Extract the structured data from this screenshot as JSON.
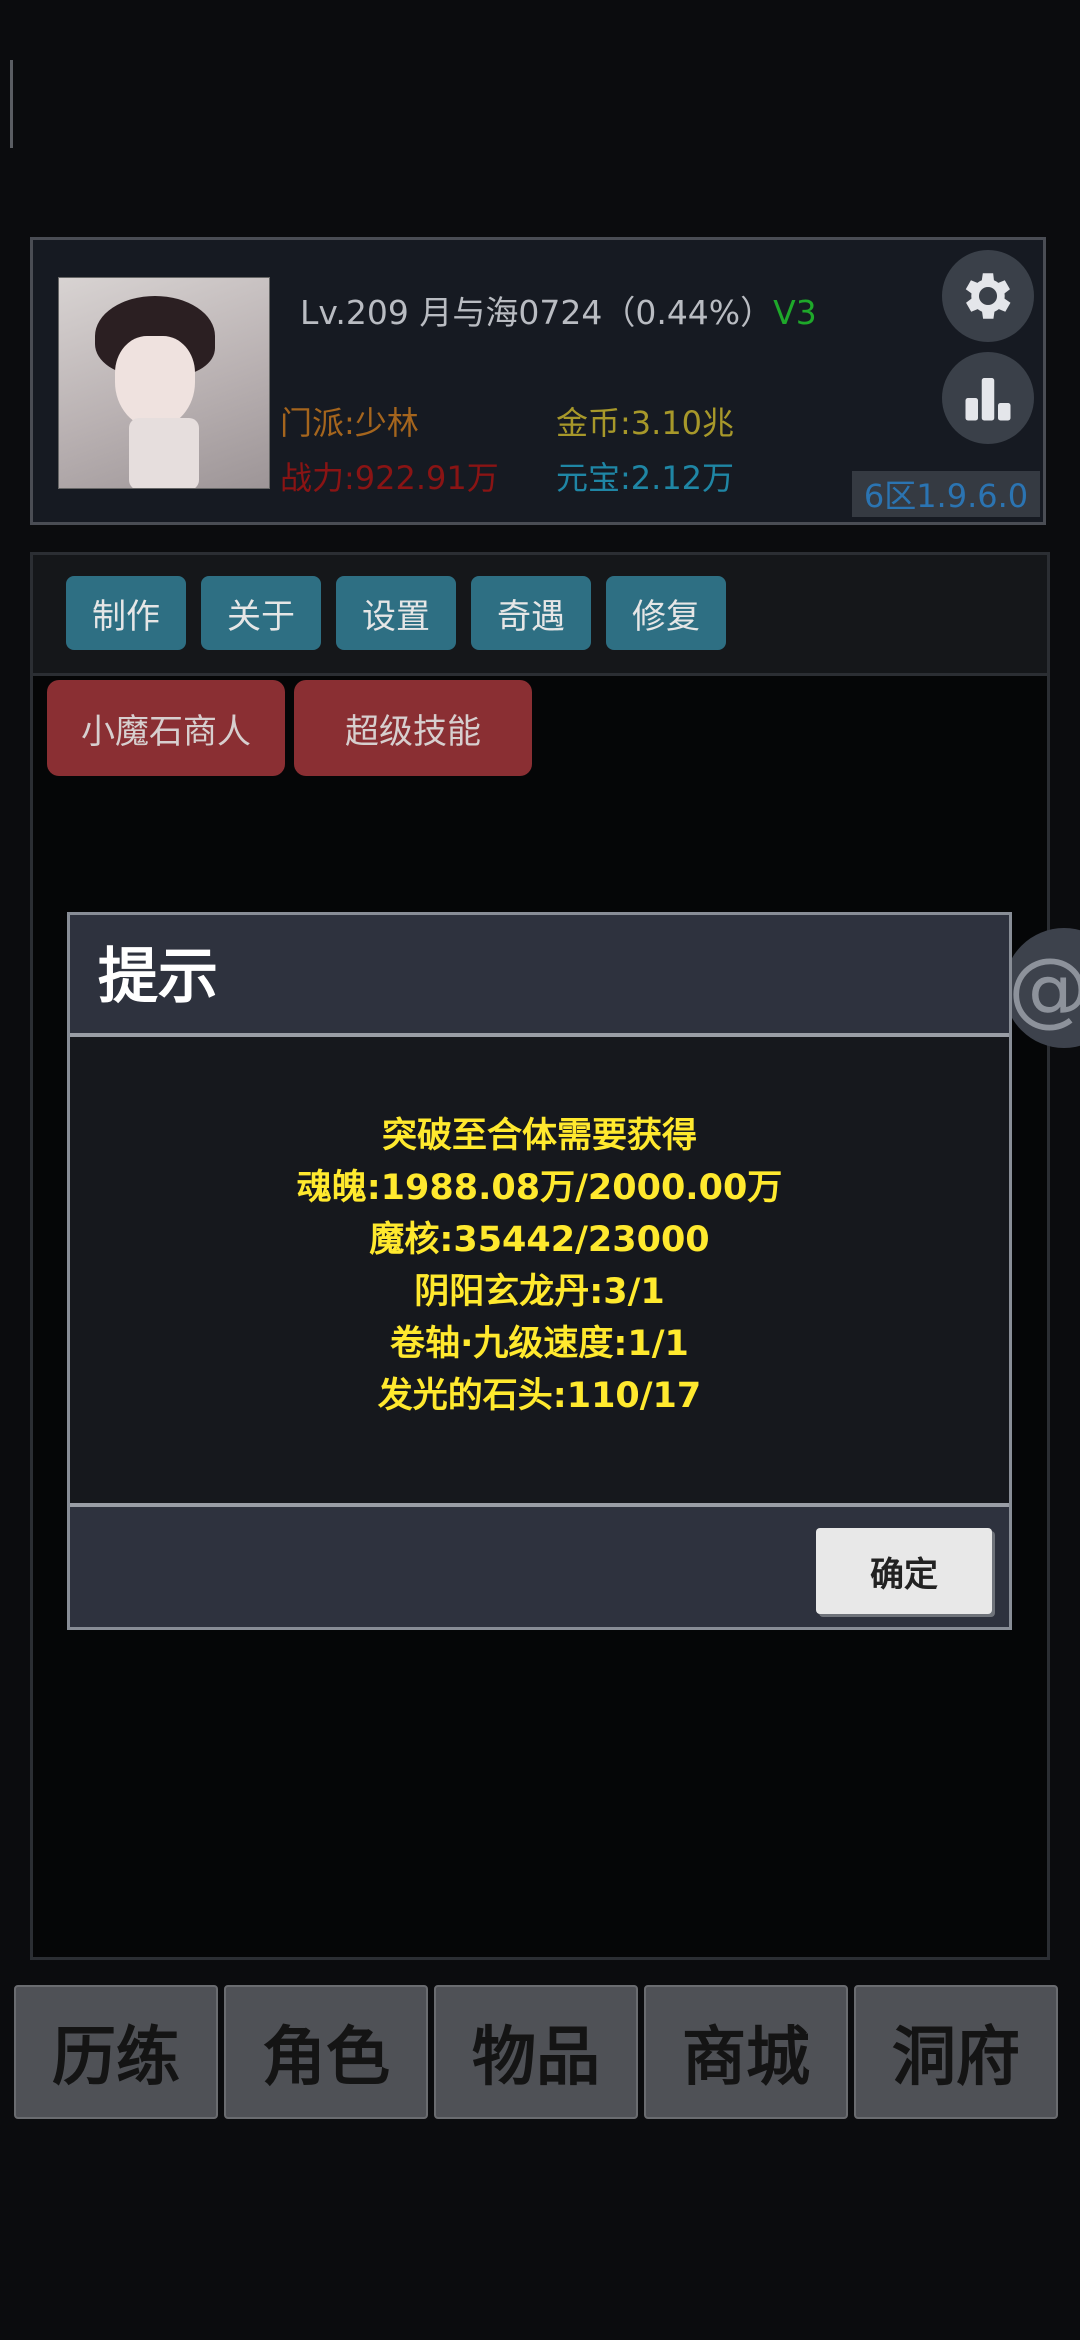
{
  "profile": {
    "level": "Lv.209",
    "name": "月与海0724",
    "progress": "（0.44%）",
    "vip": "V3",
    "sect": "门派:少林",
    "gold": "金币:3.10兆",
    "power": "战力:922.91万",
    "ingot": "元宝:2.12万",
    "server": "6区1.9.6.0",
    "icons": {
      "settings": "gear-icon",
      "stats": "bar-chart-icon"
    }
  },
  "menu": {
    "items": [
      "制作",
      "关于",
      "设置",
      "奇遇",
      "修复"
    ]
  },
  "features": {
    "items": [
      "小魔石商人",
      "超级技能"
    ]
  },
  "dialog": {
    "title": "提示",
    "lines": [
      "突破至合体需要获得",
      "魂魄:1988.08万/2000.00万",
      "魔核:35442/23000",
      "阴阳玄龙丹:3/1",
      "卷轴·九级速度:1/1",
      "发光的石头:110/17"
    ],
    "confirm": "确定"
  },
  "float_button": {
    "label": "@"
  },
  "bottom_nav": {
    "tabs": [
      "历练",
      "角色",
      "物品",
      "商城",
      "洞府"
    ]
  },
  "colors": {
    "vip": "#1ea82a",
    "sect": "#a5651d",
    "gold": "#a7982a",
    "power": "#8a1414",
    "ingot": "#1f86a5",
    "dialog_text": "#ffe92e",
    "menu_button": "#2e6f83",
    "feature_button": "#8a2f33"
  }
}
